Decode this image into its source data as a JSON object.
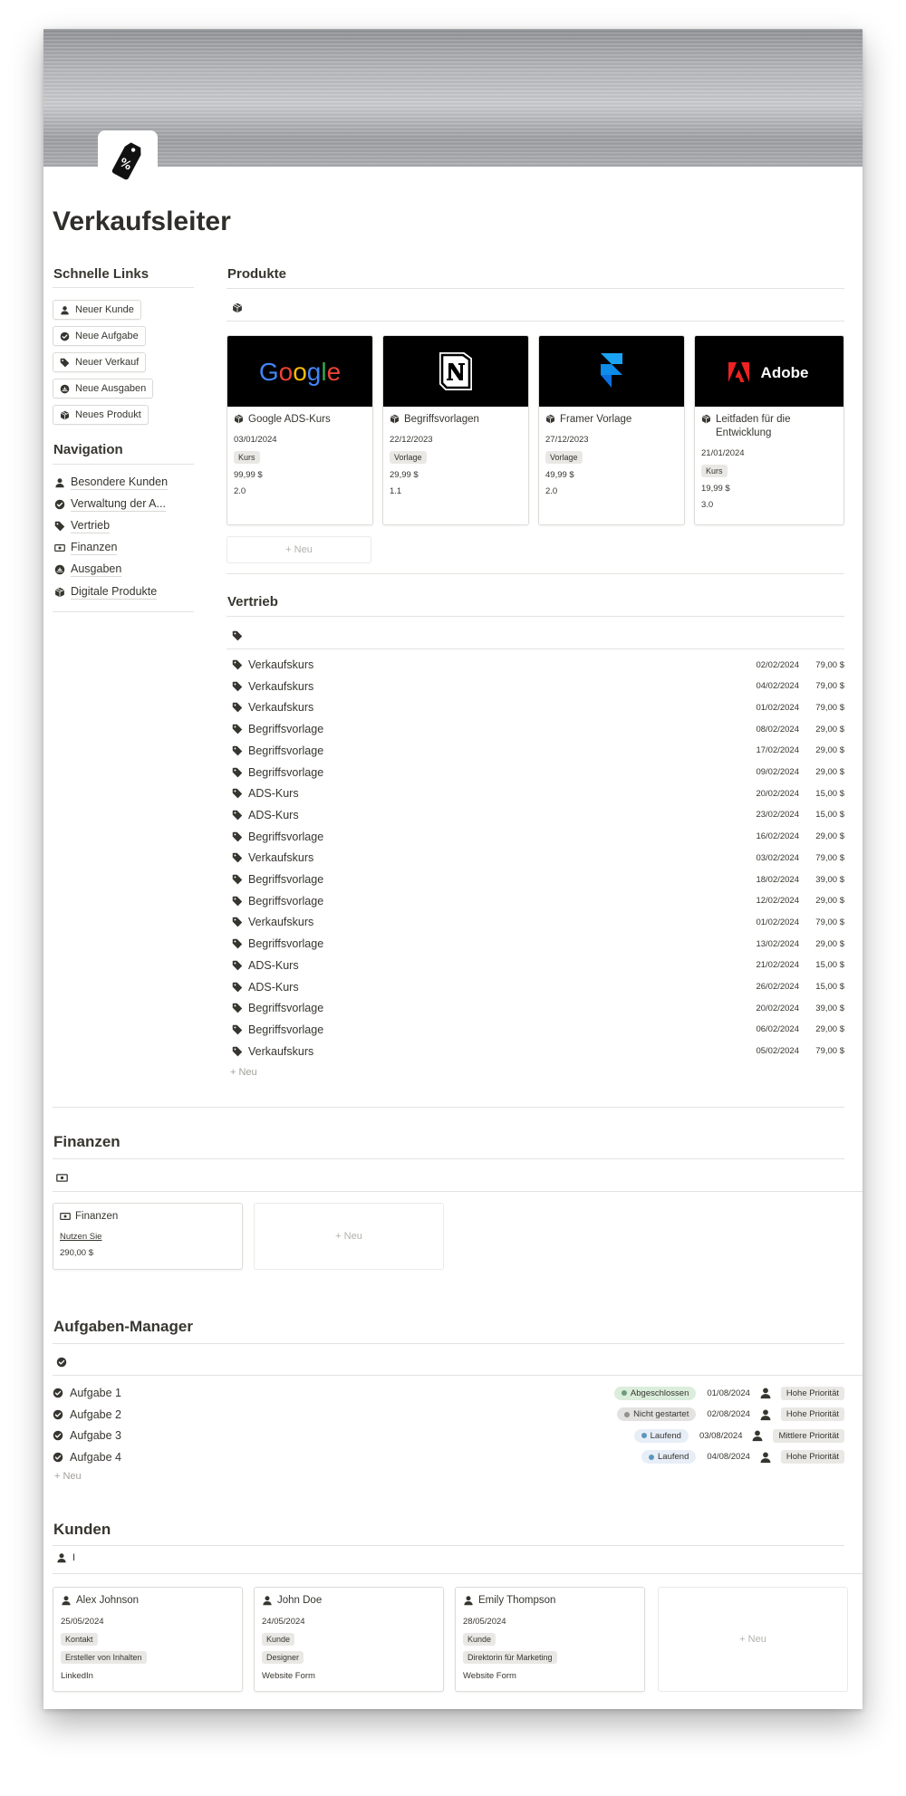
{
  "page": {
    "title": "Verkaufsleiter"
  },
  "quick_links": {
    "heading": "Schnelle Links",
    "buttons": [
      {
        "label": "Neuer Kunde",
        "icon": "person-icon"
      },
      {
        "label": "Neue Aufgabe",
        "icon": "check-circle-icon"
      },
      {
        "label": "Neuer Verkauf",
        "icon": "tag-icon"
      },
      {
        "label": "Neue Ausgaben",
        "icon": "wallet-icon"
      },
      {
        "label": "Neues Produkt",
        "icon": "package-icon"
      }
    ]
  },
  "navigation": {
    "heading": "Navigation",
    "items": [
      {
        "label": "Besondere Kunden",
        "icon": "person-icon"
      },
      {
        "label": "Verwaltung der A...",
        "icon": "check-circle-icon"
      },
      {
        "label": "Vertrieb",
        "icon": "tag-icon"
      },
      {
        "label": "Finanzen",
        "icon": "money-icon"
      },
      {
        "label": "Ausgaben",
        "icon": "wallet-icon"
      },
      {
        "label": "Digitale Produkte",
        "icon": "package-icon"
      }
    ]
  },
  "products": {
    "heading": "Produkte",
    "new_label": "Neu",
    "cards": [
      {
        "brand": "Google",
        "name": "Google ADS-Kurs",
        "date": "03/01/2024",
        "type": "Kurs",
        "price": "99,99 $",
        "version": "2.0"
      },
      {
        "brand": "Notion",
        "name": "Begriffsvorlagen",
        "date": "22/12/2023",
        "type": "Vorlage",
        "price": "29,99 $",
        "version": "1.1"
      },
      {
        "brand": "Framer",
        "name": "Framer Vorlage",
        "date": "27/12/2023",
        "type": "Vorlage",
        "price": "49,99 $",
        "version": "2.0"
      },
      {
        "brand": "Adobe",
        "name": "Leitfaden für die Entwicklung",
        "date": "21/01/2024",
        "type": "Kurs",
        "price": "19,99 $",
        "version": "3.0"
      }
    ]
  },
  "sales": {
    "heading": "Vertrieb",
    "new_label": "Neu",
    "rows": [
      {
        "name": "Verkaufskurs",
        "date": "02/02/2024",
        "price": "79,00 $"
      },
      {
        "name": "Verkaufskurs",
        "date": "04/02/2024",
        "price": "79,00 $"
      },
      {
        "name": "Verkaufskurs",
        "date": "01/02/2024",
        "price": "79,00 $"
      },
      {
        "name": "Begriffsvorlage",
        "date": "08/02/2024",
        "price": "29,00 $"
      },
      {
        "name": "Begriffsvorlage",
        "date": "17/02/2024",
        "price": "29,00 $"
      },
      {
        "name": "Begriffsvorlage",
        "date": "09/02/2024",
        "price": "29,00 $"
      },
      {
        "name": "ADS-Kurs",
        "date": "20/02/2024",
        "price": "15,00 $"
      },
      {
        "name": "ADS-Kurs",
        "date": "23/02/2024",
        "price": "15,00 $"
      },
      {
        "name": "Begriffsvorlage",
        "date": "16/02/2024",
        "price": "29,00 $"
      },
      {
        "name": "Verkaufskurs",
        "date": "03/02/2024",
        "price": "79,00 $"
      },
      {
        "name": "Begriffsvorlage",
        "date": "18/02/2024",
        "price": "39,00 $"
      },
      {
        "name": "Begriffsvorlage",
        "date": "12/02/2024",
        "price": "29,00 $"
      },
      {
        "name": "Verkaufskurs",
        "date": "01/02/2024",
        "price": "79,00 $"
      },
      {
        "name": "Begriffsvorlage",
        "date": "13/02/2024",
        "price": "29,00 $"
      },
      {
        "name": "ADS-Kurs",
        "date": "21/02/2024",
        "price": "15,00 $"
      },
      {
        "name": "ADS-Kurs",
        "date": "26/02/2024",
        "price": "15,00 $"
      },
      {
        "name": "Begriffsvorlage",
        "date": "20/02/2024",
        "price": "39,00 $"
      },
      {
        "name": "Begriffsvorlage",
        "date": "06/02/2024",
        "price": "29,00 $"
      },
      {
        "name": "Verkaufskurs",
        "date": "05/02/2024",
        "price": "79,00 $"
      }
    ]
  },
  "finances": {
    "heading": "Finanzen",
    "new_label": "Neu",
    "card": {
      "name": "Finanzen",
      "link": "Nutzen Sie",
      "amount": "290,00 $"
    }
  },
  "tasks": {
    "heading": "Aufgaben-Manager",
    "new_label": "Neu",
    "rows": [
      {
        "name": "Aufgabe 1",
        "status": "Abgeschlossen",
        "status_bg": "#dbeddb",
        "status_dot": "#6c9b7d",
        "date": "01/08/2024",
        "priority": "Hohe Priorität"
      },
      {
        "name": "Aufgabe 2",
        "status": "Nicht gestartet",
        "status_bg": "#e3e2e0",
        "status_dot": "#91918e",
        "date": "02/08/2024",
        "priority": "Hohe Priorität"
      },
      {
        "name": "Aufgabe 3",
        "status": "Laufend",
        "status_bg": "#e8eef7",
        "status_dot": "#5b97bd",
        "date": "03/08/2024",
        "priority": "Mittlere Priorität"
      },
      {
        "name": "Aufgabe 4",
        "status": "Laufend",
        "status_bg": "#e8eef7",
        "status_dot": "#5b97bd",
        "date": "04/08/2024",
        "priority": "Hohe Priorität"
      }
    ]
  },
  "customers": {
    "heading": "Kunden",
    "filter_label": "I",
    "new_label": "Neu",
    "cards": [
      {
        "name": "Alex Johnson",
        "date": "25/05/2024",
        "type": "Kontakt",
        "role": "Ersteller von Inhalten",
        "source": "LinkedIn"
      },
      {
        "name": "John Doe",
        "date": "24/05/2024",
        "type": "Kunde",
        "role": "Designer",
        "source": "Website Form"
      },
      {
        "name": "Emily Thompson",
        "date": "28/05/2024",
        "type": "Kunde",
        "role": "Direktorin für Marketing",
        "source": "Website Form"
      }
    ]
  },
  "colors": {
    "text": "#37352f",
    "muted": "#a19f9a",
    "tag_bg": "#e9e8e5"
  }
}
